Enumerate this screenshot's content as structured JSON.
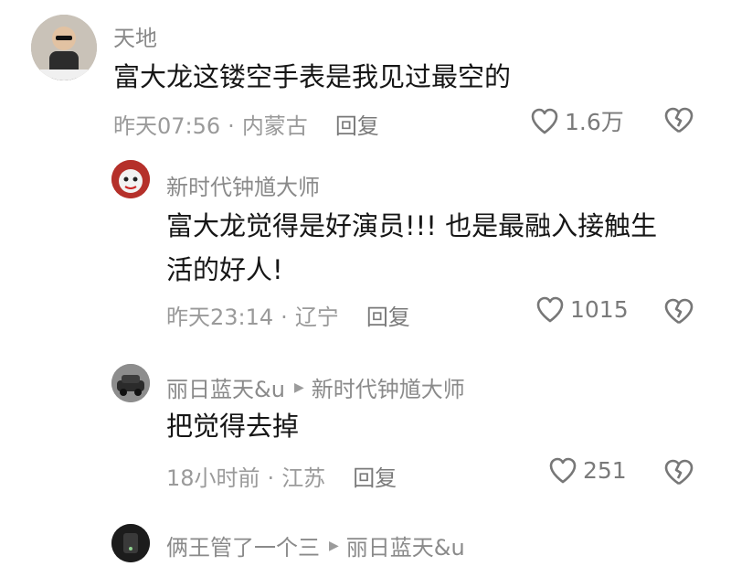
{
  "comments": [
    {
      "username": "天地",
      "text": "富大龙这镂空手表是我见过最空的",
      "time": "昨天07:56",
      "location": "内蒙古",
      "reply_label": "回复",
      "likes": "1.6万",
      "avatar_icon": "person-sunglasses-avatar"
    },
    {
      "username": "新时代钟馗大师",
      "text_line1": "富大龙觉得是好演员!!! 也是最融入接触生",
      "text_line2": "活的好人!",
      "time": "昨天23:14",
      "location": "辽宁",
      "reply_label": "回复",
      "likes": "1015",
      "avatar_icon": "red-mask-avatar"
    },
    {
      "username": "丽日蓝天&u",
      "reply_to": "新时代钟馗大师",
      "text": "把觉得去掉",
      "time": "18小时前",
      "location": "江苏",
      "reply_label": "回复",
      "likes": "251",
      "avatar_icon": "car-avatar"
    },
    {
      "username": "俩王管了一个三",
      "reply_to": "丽日蓝天&u",
      "avatar_icon": "dark-device-avatar"
    }
  ]
}
